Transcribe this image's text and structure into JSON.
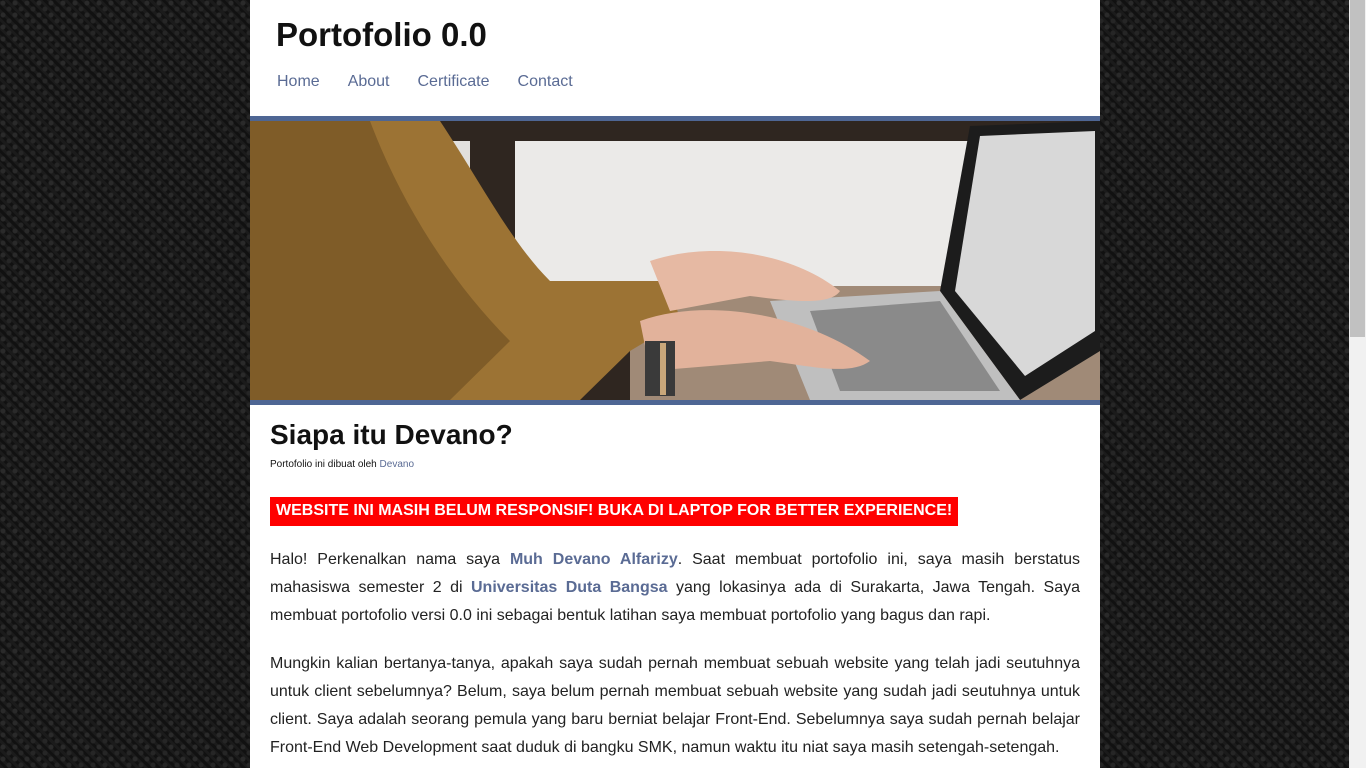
{
  "header": {
    "title": "Portofolio 0.0",
    "nav": [
      "Home",
      "About",
      "Certificate",
      "Contact"
    ]
  },
  "hero": {
    "image": "woman typing on laptop"
  },
  "main": {
    "title": "Siapa itu Devano?",
    "byline_prefix": "Portofolio ini dibuat oleh",
    "byline_link": "Devano",
    "warning": "WEBSITE INI MASIH BELUM RESPONSIF! BUKA DI LAPTOP FOR BETTER EXPERIENCE!",
    "para1": {
      "t1": "Halo! Perkenalkan nama saya ",
      "name": "Muh Devano Alfarizy",
      "t2": ". Saat membuat portofolio ini, saya masih berstatus mahasiswa semester 2 di ",
      "university": "Universitas Duta Bangsa",
      "t3": " yang lokasinya ada di Surakarta, Jawa Tengah. Saya membuat portofolio versi 0.0 ini sebagai bentuk latihan saya membuat portofolio yang bagus dan rapi."
    },
    "para2": "Mungkin kalian bertanya-tanya, apakah saya sudah pernah membuat sebuah website yang telah jadi seutuhnya untuk client sebelumnya? Belum, saya belum pernah membuat sebuah website yang sudah jadi seutuhnya untuk client. Saya adalah seorang pemula yang baru berniat belajar Front-End. Sebelumnya saya sudah pernah belajar Front-End Web Development saat duduk di bangku SMK, namun waktu itu niat saya masih setengah-setengah."
  },
  "colors": {
    "accent": "#5a6b94",
    "hero_border": "#4e6694",
    "warning_bg": "#ff0000",
    "page_bg": "#141414"
  }
}
